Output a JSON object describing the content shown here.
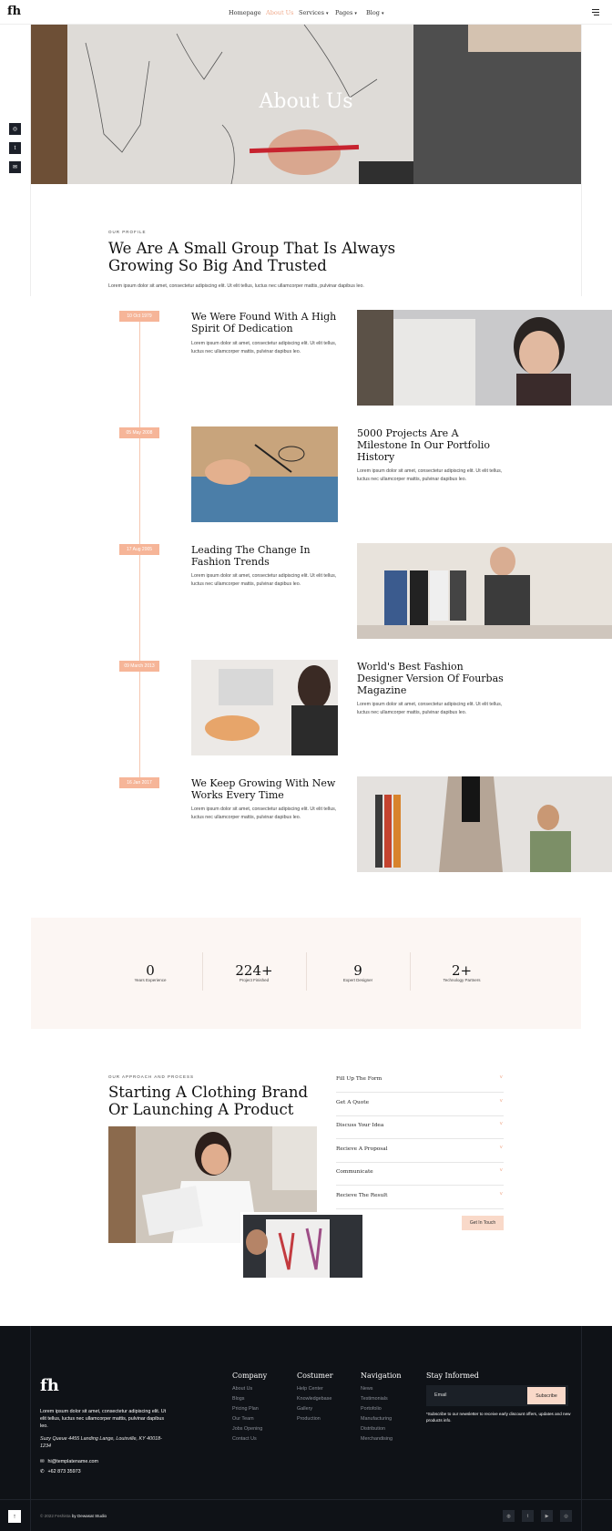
{
  "header": {
    "logo": "fh",
    "nav": [
      {
        "label": "Homepage",
        "active": false,
        "dropdown": false
      },
      {
        "label": "About Us",
        "active": true,
        "dropdown": false
      },
      {
        "label": "Services",
        "active": false,
        "dropdown": true
      },
      {
        "label": "Pages",
        "active": false,
        "dropdown": true
      },
      {
        "label": "Blog",
        "active": false,
        "dropdown": true
      }
    ],
    "menu_icon": "hamburger-icon"
  },
  "side_social": [
    "instagram-icon",
    "twitter-icon",
    "email-icon"
  ],
  "hero": {
    "title": "About Us"
  },
  "profile": {
    "eyebrow": "OUR PROFILE",
    "title": "We Are A Small Group That Is Always Growing So Big And Trusted",
    "text": "Lorem ipsum dolor sit amet, consectetur adipiscing elit. Ut elit tellus, luctus nec ullamcorper mattis, pulvinar dapibus leo."
  },
  "timeline": [
    {
      "date": "10 Oct 1979",
      "title": "We Were Found With A High Spirit Of Dedication",
      "text": "Lorem ipsum dolor sit amet, consectetur adipiscing elit. Ut elit tellus, luctus nec ullamcorper mattis, pulvinar dapibus leo."
    },
    {
      "date": "05 May 2008",
      "title": "5000 Projects Are A Milestone In Our Portfolio History",
      "text": "Lorem ipsum dolor sit amet, consectetur adipiscing elit. Ut elit tellus, luctus nec ullamcorper mattis, pulvinar dapibus leo."
    },
    {
      "date": "17 Aug 2005",
      "title": "Leading The Change In Fashion Trends",
      "text": "Lorem ipsum dolor sit amet, consectetur adipiscing elit. Ut elit tellus, luctus nec ullamcorper mattis, pulvinar dapibus leo."
    },
    {
      "date": "09 March 2013",
      "title": "World's Best Fashion Designer Version Of Fourbas Magazine",
      "text": "Lorem ipsum dolor sit amet, consectetur adipiscing elit. Ut elit tellus, luctus nec ullamcorper mattis, pulvinar dapibus leo."
    },
    {
      "date": "16 Jan 2017",
      "title": "We Keep Growing With New Works Every Time",
      "text": "Lorem ipsum dolor sit amet, consectetur adipiscing elit. Ut elit tellus, luctus nec ullamcorper mattis, pulvinar dapibus leo."
    }
  ],
  "stats": [
    {
      "value": "0",
      "label": "Years Experience"
    },
    {
      "value": "224+",
      "label": "Project Finished"
    },
    {
      "value": "9",
      "label": "Expert Designer"
    },
    {
      "value": "2+",
      "label": "Technology Partners"
    }
  ],
  "approach": {
    "eyebrow": "OUR APPROACH AND PROCESS",
    "title": "Starting A Clothing Brand Or Launching A Product",
    "accordion": [
      "Fill Up The Form",
      "Get A Quote",
      "Discuss Your Idea",
      "Recieve A Proposal",
      "Communicate",
      "Recieve The Result"
    ],
    "button": "Get In Touch"
  },
  "footer": {
    "logo": "fh",
    "about": "Lorem ipsum dolor sit amet, consectetur adipiscing elit. Ut elit tellus, luctus nec ullamcorper mattis, pulvinar dapibus leo.",
    "address": "Suzy Queue 4455 Landing Lange, Louisville, KY 40018-1234",
    "email": "hi@templatename.com",
    "phone": "+62 873 35973",
    "columns": [
      {
        "title": "Company",
        "links": [
          "About Us",
          "Blogs",
          "Pricing Plan",
          "Our Team",
          "Jobs Opening",
          "Contact Us"
        ]
      },
      {
        "title": "Costumer",
        "links": [
          "Help Center",
          "Knowledgebase",
          "Gallery",
          "Production"
        ]
      },
      {
        "title": "Navigation",
        "links": [
          "News",
          "Testimonials",
          "Portofolio",
          "Manufacturing",
          "Distribution",
          "Merchandising"
        ]
      }
    ],
    "newsletter": {
      "title": "Stay Informed",
      "placeholder": "Email",
      "button": "Subscribe",
      "note": "*Subscribe to our newsletter to receive early discount offers, updates and new products info."
    },
    "copyright_prefix": "© 2022 Feshista",
    "copyright_brand": "by Dewasat Studio",
    "social": [
      "dribbble-icon",
      "twitter-icon",
      "youtube-icon",
      "instagram-icon"
    ]
  },
  "colors": {
    "accent": "#f6b598",
    "dark": "#0f1217",
    "cream": "#fcf6f3"
  }
}
